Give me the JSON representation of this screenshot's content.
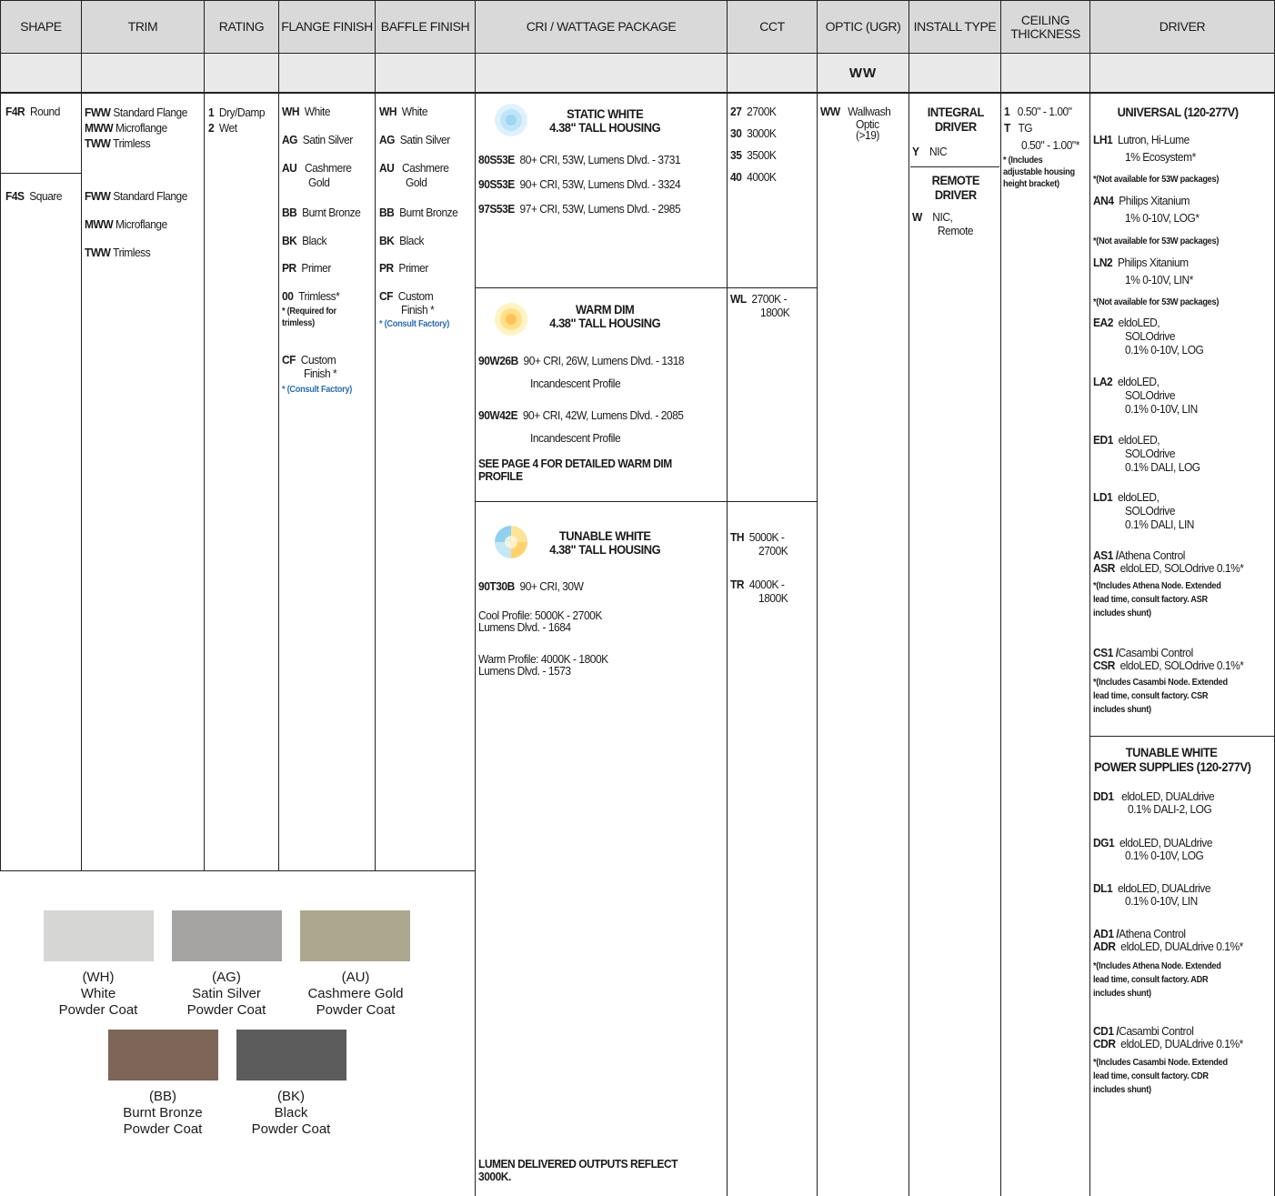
{
  "headers": {
    "shape": "SHAPE",
    "trim": "TRIM",
    "rating": "RATING",
    "flange": "FLANGE FINISH",
    "baffle": "BAFFLE FINISH",
    "cri": "CRI / WATTAGE PACKAGE",
    "cct": "CCT",
    "optic": "OPTIC (UGR)",
    "install": "INSTALL TYPE",
    "ceiling1": "CEILING",
    "ceiling2": "THICKNESS",
    "driver": "DRIVER"
  },
  "optic_sub": "WW",
  "shape": [
    {
      "code": "F4R",
      "label": "Round"
    },
    {
      "code": "F4S",
      "label": "Square"
    }
  ],
  "trim_round": [
    {
      "code": "FWW",
      "label": "Standard Flange"
    },
    {
      "code": "MWW",
      "label": "Microflange"
    },
    {
      "code": "TWW",
      "label": "Trimless"
    }
  ],
  "trim_square": [
    {
      "code": "FWW",
      "label": "Standard Flange"
    },
    {
      "code": "MWW",
      "label": "Microflange"
    },
    {
      "code": "TWW",
      "label": "Trimless"
    }
  ],
  "rating": [
    {
      "code": "1",
      "label": "Dry/Damp"
    },
    {
      "code": "2",
      "label": "Wet"
    }
  ],
  "flange": [
    {
      "code": "WH",
      "label": "White"
    },
    {
      "code": "AG",
      "label": "Satin Silver"
    },
    {
      "code": "AU",
      "label": "Cashmere",
      "label2": "Gold"
    },
    {
      "code": "BB",
      "label": "Burnt Bronze"
    },
    {
      "code": "BK",
      "label": "Black"
    },
    {
      "code": "PR",
      "label": "Primer"
    },
    {
      "code": "00",
      "label": "Trimless*"
    },
    {
      "code": "CF",
      "label": "Custom",
      "label2": "Finish *"
    }
  ],
  "flange_note1": "* (Required for",
  "flange_note2": "trimless)",
  "flange_cf_note": "* (Consult Factory)",
  "baffle": [
    {
      "code": "WH",
      "label": "White"
    },
    {
      "code": "AG",
      "label": "Satin Silver"
    },
    {
      "code": "AU",
      "label": "Cashmere",
      "label2": "Gold"
    },
    {
      "code": "BB",
      "label": "Burnt Bronze"
    },
    {
      "code": "BK",
      "label": "Black"
    },
    {
      "code": "PR",
      "label": "Primer"
    },
    {
      "code": "CF",
      "label": "Custom",
      "label2": "Finish *"
    }
  ],
  "baffle_cf_note": "* (Consult Factory)",
  "static": {
    "title1": "STATIC WHITE",
    "title2": "4.38\" TALL HOUSING",
    "rows": [
      {
        "code": "80S53E",
        "label": "80+ CRI, 53W, Lumens Dlvd. - 3731"
      },
      {
        "code": "90S53E",
        "label": "90+ CRI, 53W, Lumens Dlvd. - 3324"
      },
      {
        "code": "97S53E",
        "label": "97+ CRI, 53W, Lumens Dlvd. - 2985"
      }
    ]
  },
  "warm": {
    "title1": "WARM DIM",
    "title2": "4.38\" TALL HOUSING",
    "rows": [
      {
        "code": "90W26B",
        "label": "90+ CRI, 26W, Lumens Dlvd. - 1318",
        "label2": "Incandescent Profile"
      },
      {
        "code": "90W42E",
        "label": "90+ CRI, 42W, Lumens Dlvd. - 2085",
        "label2": "Incandescent Profile"
      }
    ],
    "note1": "SEE PAGE 4 FOR DETAILED WARM DIM",
    "note2": "PROFILE"
  },
  "tunable": {
    "title1": "TUNABLE WHITE",
    "title2": "4.38\" TALL HOUSING",
    "code": "90T30B",
    "label": "90+ CRI, 30W",
    "cool1": "Cool  Profile: 5000K - 2700K",
    "cool2": "Lumens Dlvd. - 1684",
    "warm1": "Warm Profile: 4000K - 1800K",
    "warm2": "Lumens Dlvd. - 1573"
  },
  "lumen_note1": "LUMEN DELIVERED OUTPUTS REFLECT",
  "lumen_note2": "3000K.",
  "cct": [
    {
      "code": "27",
      "label": "2700K"
    },
    {
      "code": "30",
      "label": "3000K"
    },
    {
      "code": "35",
      "label": "3500K"
    },
    {
      "code": "40",
      "label": "4000K"
    }
  ],
  "cct_wl": {
    "code": "WL",
    "label": "2700K -",
    "label2": "1800K"
  },
  "cct_th": {
    "code": "TH",
    "label": "5000K -",
    "label2": "2700K"
  },
  "cct_tr": {
    "code": "TR",
    "label": "4000K -",
    "label2": "1800K"
  },
  "optic": {
    "code": "WW",
    "label": "Wallwash",
    "label2": "Optic",
    "label3": "(>19)"
  },
  "install": {
    "integral1": "INTEGRAL",
    "integral2": "DRIVER",
    "y_code": "Y",
    "y_label": "NIC",
    "remote1": "REMOTE",
    "remote2": "DRIVER",
    "w_code": "W",
    "w_label": "NIC,",
    "w_label2": "Remote"
  },
  "ceiling": {
    "c1_code": "1",
    "c1_label": "0.50\" - 1.00\"",
    "t_code": "T",
    "t_label": "TG",
    "t_label2": "0.50\" - 1.00\"*",
    "note1": "* (Includes",
    "note2": "adjustable housing",
    "note3": "height bracket)"
  },
  "driver": {
    "universal": "UNIVERSAL (120-277V)",
    "lh1": {
      "code": "LH1",
      "l1": "Lutron, Hi-Lume",
      "l2": "1% Ecosystem*"
    },
    "na1": "*(Not available for 53W packages)",
    "an4": {
      "code": "AN4",
      "l1": "Philips Xitanium",
      "l2": "1% 0-10V, LOG*"
    },
    "na2": "*(Not available for 53W packages)",
    "ln2": {
      "code": "LN2",
      "l1": "Philips Xitanium",
      "l2": "1% 0-10V, LIN*"
    },
    "na3": "*(Not available for 53W packages)",
    "ea2": {
      "code": "EA2",
      "l1": "eldoLED,",
      "l2": "SOLOdrive",
      "l3": "0.1% 0-10V, LOG"
    },
    "la2": {
      "code": "LA2",
      "l1": "eldoLED,",
      "l2": "SOLOdrive",
      "l3": "0.1% 0-10V, LIN"
    },
    "ed1": {
      "code": "ED1",
      "l1": "eldoLED,",
      "l2": "SOLOdrive",
      "l3": "0.1% DALI, LOG"
    },
    "ld1": {
      "code": "LD1",
      "l1": "eldoLED,",
      "l2": "SOLOdrive",
      "l3": "0.1% DALI, LIN"
    },
    "as1": {
      "code": "AS1 /",
      "l1": "Athena Control",
      "code2": "ASR",
      "l2": "eldoLED, SOLOdrive 0.1%*",
      "n1": "*(Includes Athena Node. Extended",
      "n2": "lead time, consult factory. ASR",
      "n3": "includes shunt)"
    },
    "cs1": {
      "code": "CS1 /",
      "l1": "Casambi Control",
      "code2": "CSR",
      "l2": "eldoLED, SOLOdrive 0.1%*",
      "n1": "*(Includes Casambi Node. Extended",
      "n2": "lead time, consult factory. CSR",
      "n3": "includes shunt)"
    },
    "tunable1": "TUNABLE WHITE",
    "tunable2": "POWER SUPPLIES (120-277V)",
    "dd1": {
      "code": "DD1",
      "l1": "eldoLED, DUALdrive",
      "l2": "0.1% DALI-2, LOG"
    },
    "dg1": {
      "code": "DG1",
      "l1": "eldoLED, DUALdrive",
      "l2": "0.1% 0-10V, LOG"
    },
    "dl1": {
      "code": "DL1",
      "l1": "eldoLED, DUALdrive",
      "l2": "0.1% 0-10V, LIN"
    },
    "ad1": {
      "code": "AD1 /",
      "l1": "Athena Control",
      "code2": "ADR",
      "l2": "eldoLED, DUALdrive 0.1%*",
      "n1": "*(Includes Athena Node. Extended",
      "n2": "lead time, consult factory. ADR",
      "n3": "includes shunt)"
    },
    "cd1": {
      "code": "CD1 /",
      "l1": "Casambi Control",
      "code2": "CDR",
      "l2": "eldoLED, DUALdrive 0.1%*",
      "n1": "*(Includes Casambi Node. Extended",
      "n2": "lead time, consult factory. CDR",
      "n3": "includes shunt)"
    }
  },
  "swatches": [
    {
      "code": "(WH)",
      "name": "White",
      "finish": "Powder Coat",
      "color": "#d6d6d4"
    },
    {
      "code": "(AG)",
      "name": "Satin Silver",
      "finish": "Powder Coat",
      "color": "#a6a4a3"
    },
    {
      "code": "(AU)",
      "name": "Cashmere Gold",
      "finish": "Powder Coat",
      "color": "#aca78f"
    },
    {
      "code": "(BB)",
      "name": "Burnt Bronze",
      "finish": "Powder Coat",
      "color": "#7d6557"
    },
    {
      "code": "(BK)",
      "name": "Black",
      "finish": "Powder Coat",
      "color": "#5c5c5c"
    }
  ]
}
